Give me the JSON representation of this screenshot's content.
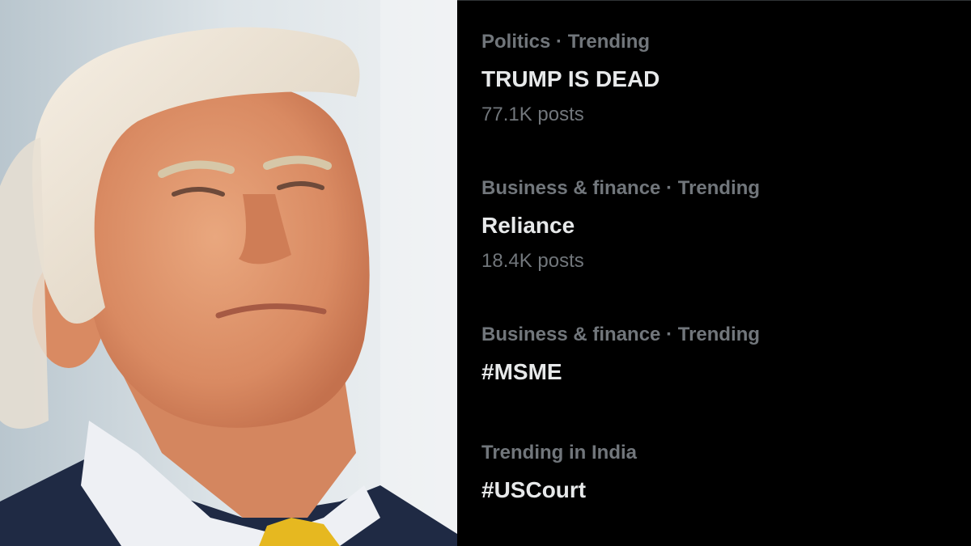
{
  "colors": {
    "background": "#000000",
    "primary_text": "#e7e9ea",
    "secondary_text": "#71767b"
  },
  "photo": {
    "icon": "portrait-photo"
  },
  "trends": [
    {
      "meta": "Politics · Trending",
      "name": "TRUMP IS DEAD",
      "count": "77.1K posts"
    },
    {
      "meta": "Business & finance · Trending",
      "name": "Reliance",
      "count": "18.4K posts"
    },
    {
      "meta": "Business & finance · Trending",
      "name": "#MSME"
    },
    {
      "meta": "Trending in India",
      "name": "#USCourt"
    }
  ]
}
